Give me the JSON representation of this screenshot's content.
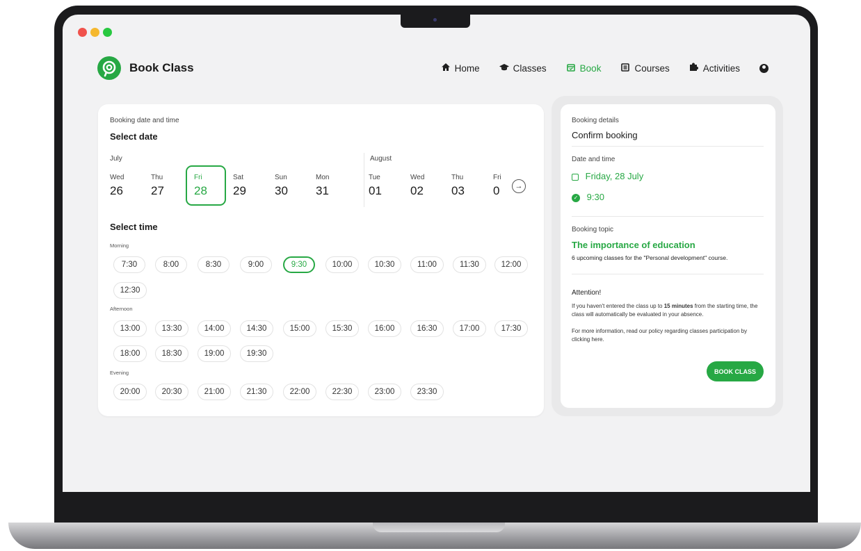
{
  "app": {
    "title": "Book Class"
  },
  "nav": {
    "items": [
      {
        "label": "Home",
        "icon": "home-icon"
      },
      {
        "label": "Classes",
        "icon": "graduation-cap-icon"
      },
      {
        "label": "Book",
        "icon": "calendar-icon"
      },
      {
        "label": "Courses",
        "icon": "book-icon"
      },
      {
        "label": "Activities",
        "icon": "puzzle-icon"
      }
    ],
    "active": "Book",
    "profile_icon": "user-circle-icon"
  },
  "booking": {
    "section_label": "Booking date and time",
    "select_date": "Select date",
    "months": [
      "July",
      "August"
    ],
    "days": [
      {
        "name": "Wed",
        "num": "26"
      },
      {
        "name": "Thu",
        "num": "27"
      },
      {
        "name": "Fri",
        "num": "28"
      },
      {
        "name": "Sat",
        "num": "29"
      },
      {
        "name": "Sun",
        "num": "30"
      },
      {
        "name": "Mon",
        "num": "31"
      },
      {
        "name": "Tue",
        "num": "01"
      },
      {
        "name": "Wed",
        "num": "02"
      },
      {
        "name": "Thu",
        "num": "03"
      },
      {
        "name": "Fri",
        "num": "0"
      }
    ],
    "selected_day_index": 2,
    "select_time": "Select time",
    "periods": [
      {
        "label": "Morning",
        "slots": [
          "7:30",
          "8:00",
          "8:30",
          "9:00",
          "9:30",
          "10:00",
          "10:30",
          "11:00",
          "11:30",
          "12:00",
          "12:30"
        ]
      },
      {
        "label": "Afternoon",
        "slots": [
          "13:00",
          "13:30",
          "14:00",
          "14:30",
          "15:00",
          "15:30",
          "16:00",
          "16:30",
          "17:00",
          "17:30",
          "18:00",
          "18:30",
          "19:00",
          "19:30"
        ]
      },
      {
        "label": "Evening",
        "slots": [
          "20:00",
          "20:30",
          "21:00",
          "21:30",
          "22:00",
          "22:30",
          "23:00",
          "23:30"
        ]
      }
    ],
    "selected_slot": "9:30"
  },
  "details": {
    "label": "Booking details",
    "title": "Confirm booking",
    "date_time_label": "Date and time",
    "date_value": "Friday, 28 July",
    "time_value": "9:30",
    "topic_label": "Booking topic",
    "topic_title": "The importance of education",
    "topic_desc": "6 upcoming classes for the \"Personal development\" course.",
    "attention_title": "Attention!",
    "attention_text_1": "If you haven't entered the class up to ",
    "attention_bold": "15 minutes",
    "attention_text_2": " from the starting time, the class will automatically be evaluated in your absence.",
    "policy_text": "For more information, read our policy regarding classes participation by clicking here.",
    "button": "BOOK CLASS"
  },
  "colors": {
    "accent": "#27a844",
    "window_red": "#f0524c",
    "window_yellow": "#f5b82e",
    "window_green": "#28c840"
  }
}
